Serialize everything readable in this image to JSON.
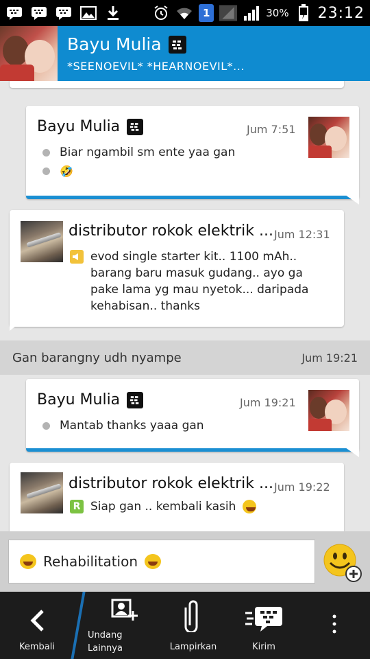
{
  "status_bar": {
    "battery": "30%",
    "time": "23:12",
    "sim_badge": "1"
  },
  "header": {
    "name": "Bayu Mulia",
    "status": "*SEENOEVIL* *HEARNOEVIL*..."
  },
  "messages": [
    {
      "sender": "Bayu Mulia",
      "time": "Jum 7:51",
      "lines": [
        "Biar ngambil sm ente yaa gan",
        "🤣"
      ]
    },
    {
      "sender": "distributor rokok elektrik ...",
      "time": "Jum 12:31",
      "text": [
        "evod single starter kit.. 1100 mAh..",
        "barang baru masuk gudang.. ayo ga",
        "pake lama yg mau nyetok... daripada",
        "kehabisan.. thanks"
      ]
    },
    {
      "system_text": "Gan barangny udh nyampe",
      "time": "Jum 19:21"
    },
    {
      "sender": "Bayu Mulia",
      "time": "Jum 19:21",
      "lines": [
        "Mantab thanks yaaa gan"
      ]
    },
    {
      "sender": "distributor rokok elektrik ...",
      "time": "Jum 19:22",
      "text": "Siap gan .. kembali kasih"
    }
  ],
  "input": {
    "value": "Rehabilitation"
  },
  "bottom_nav": {
    "back": "Kembali",
    "invite_line1": "Undang",
    "invite_line2": "Lainnya",
    "attach": "Lampirkan",
    "send": "Kirim"
  },
  "colors": {
    "header_blue": "#0f8bd0",
    "accent_blue": "#1b8fd2",
    "status_bar": "#000000",
    "bottom_bar": "#1c1c1c"
  }
}
